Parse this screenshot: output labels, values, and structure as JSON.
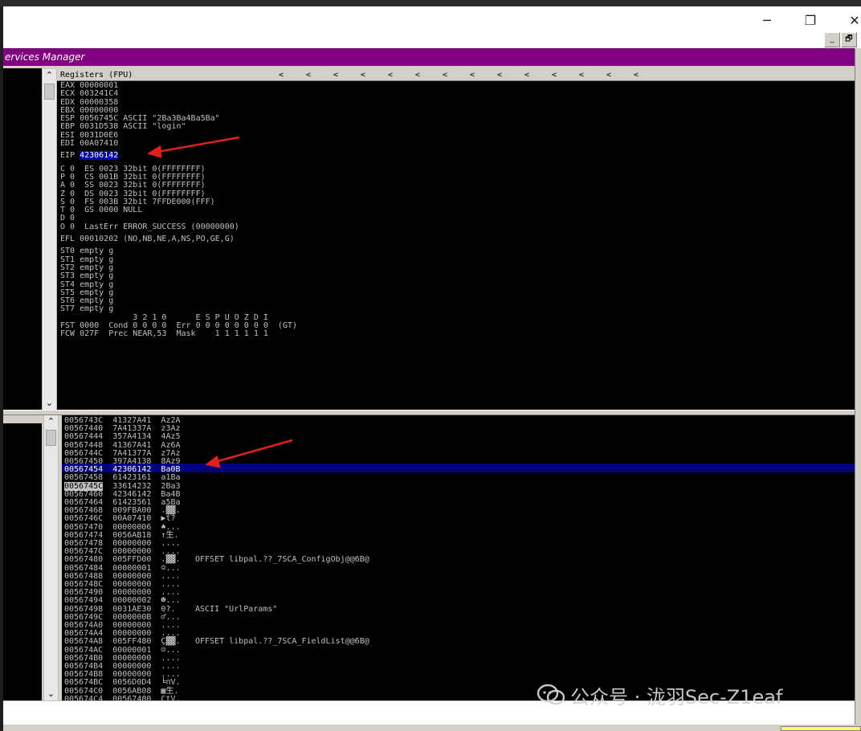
{
  "window": {
    "minimize": "─",
    "restore": "❐",
    "close": "✕",
    "mdi_minimize": "_",
    "mdi_restore": "🗗"
  },
  "mdi_title": "ervices Manager",
  "registers": {
    "header": "Registers (FPU)",
    "arrows": [
      "<",
      "<",
      "<",
      "<",
      "<",
      "<",
      "<",
      "<",
      "<",
      "<",
      "<",
      "<",
      "<",
      "<"
    ],
    "lines1": [
      "EAX 00000001",
      "ECX 003241C4",
      "EDX 00000358",
      "EBX 00000000",
      "ESP 0056745C ASCII \"2Ba3Ba4Ba5Ba\"",
      "EBP 0031D538 ASCII \"login\"",
      "ESI 0031D0E6",
      "EDI 00A07410"
    ],
    "eip_label": "EIP ",
    "eip_value": "42306142",
    "flags": [
      "C 0  ES 0023 32bit 0(FFFFFFFF)",
      "P 0  CS 001B 32bit 0(FFFFFFFF)",
      "A 0  SS 0023 32bit 0(FFFFFFFF)",
      "Z 0  DS 0023 32bit 0(FFFFFFFF)",
      "S 0  FS 003B 32bit 7FFDE000(FFF)",
      "T 0  GS 0000 NULL",
      "D 0",
      "O 0  LastErr ERROR_SUCCESS (00000000)"
    ],
    "efl": "EFL 00010202 (NO,NB,NE,A,NS,PO,GE,G)",
    "st": [
      "ST0 empty g",
      "ST1 empty g",
      "ST2 empty g",
      "ST3 empty g",
      "ST4 empty g",
      "ST5 empty g",
      "ST6 empty g",
      "ST7 empty g"
    ],
    "fpu": [
      "               3 2 1 0      E S P U O Z D I",
      "FST 0000  Cond 0 0 0 0  Err 0 0 0 0 0 0 0 0  (GT)",
      "FCW 027F  Prec NEAR,53  Mask    1 1 1 1 1 1"
    ]
  },
  "stack": {
    "rows": [
      {
        "addr": "0056743C",
        "val": "41327A41",
        "ascii": "Az2A",
        "comment": ""
      },
      {
        "addr": "00567440",
        "val": "7A41337A",
        "ascii": "z3Az",
        "comment": ""
      },
      {
        "addr": "00567444",
        "val": "357A4134",
        "ascii": "4Az5",
        "comment": ""
      },
      {
        "addr": "00567448",
        "val": "41367A41",
        "ascii": "Az6A",
        "comment": ""
      },
      {
        "addr": "0056744C",
        "val": "7A41377A",
        "ascii": "z7Az",
        "comment": ""
      },
      {
        "addr": "00567450",
        "val": "397A4138",
        "ascii": "8Az9",
        "comment": ""
      },
      {
        "addr": "00567454",
        "val": "42306142",
        "ascii": "Ba0B",
        "comment": ""
      },
      {
        "addr": "00567458",
        "val": "61423161",
        "ascii": "a1Ba",
        "comment": ""
      },
      {
        "addr": "0056745C",
        "val": "33614232",
        "ascii": "2Ba3",
        "comment": ""
      },
      {
        "addr": "00567460",
        "val": "42346142",
        "ascii": "Ba4B",
        "comment": ""
      },
      {
        "addr": "00567464",
        "val": "61423561",
        "ascii": "a5Ba",
        "comment": ""
      },
      {
        "addr": "00567468",
        "val": "009FBA00",
        "ascii": ".▓▓.",
        "comment": ""
      },
      {
        "addr": "0056746C",
        "val": "00A07410",
        "ascii": "▶t?",
        "comment": ""
      },
      {
        "addr": "00567470",
        "val": "00000006",
        "ascii": "♠...",
        "comment": ""
      },
      {
        "addr": "00567474",
        "val": "0056AB18",
        "ascii": "↑生.",
        "comment": ""
      },
      {
        "addr": "00567478",
        "val": "00000000",
        "ascii": "....",
        "comment": ""
      },
      {
        "addr": "0056747C",
        "val": "00000000",
        "ascii": "....",
        "comment": ""
      },
      {
        "addr": "00567480",
        "val": "005FFD00",
        "ascii": ".▓▓.",
        "comment": "OFFSET libpal.??_7SCA_ConfigObj@@6B@"
      },
      {
        "addr": "00567484",
        "val": "00000001",
        "ascii": "☺...",
        "comment": ""
      },
      {
        "addr": "00567488",
        "val": "00000000",
        "ascii": "....",
        "comment": ""
      },
      {
        "addr": "0056748C",
        "val": "00000000",
        "ascii": "....",
        "comment": ""
      },
      {
        "addr": "00567490",
        "val": "00000000",
        "ascii": "....",
        "comment": ""
      },
      {
        "addr": "00567494",
        "val": "00000002",
        "ascii": "☻...",
        "comment": ""
      },
      {
        "addr": "00567498",
        "val": "0031AE30",
        "ascii": "0?.",
        "comment": "ASCII \"UrlParams\""
      },
      {
        "addr": "0056749C",
        "val": "0000000B",
        "ascii": "♂...",
        "comment": ""
      },
      {
        "addr": "005674A0",
        "val": "00000000",
        "ascii": "....",
        "comment": ""
      },
      {
        "addr": "005674A4",
        "val": "00000000",
        "ascii": "....",
        "comment": ""
      },
      {
        "addr": "005674A8",
        "val": "005FF480",
        "ascii": "Ç▓▓.",
        "comment": "OFFSET libpal.??_7SCA_FieldList@@6B@"
      },
      {
        "addr": "005674AC",
        "val": "00000001",
        "ascii": "☺...",
        "comment": ""
      },
      {
        "addr": "005674B0",
        "val": "00000000",
        "ascii": "....",
        "comment": ""
      },
      {
        "addr": "005674B4",
        "val": "00000000",
        "ascii": "....",
        "comment": ""
      },
      {
        "addr": "005674B8",
        "val": "00000000",
        "ascii": "....",
        "comment": ""
      },
      {
        "addr": "005674BC",
        "val": "0056D0D4",
        "ascii": "╘пV.",
        "comment": ""
      },
      {
        "addr": "005674C0",
        "val": "0056AB08",
        "ascii": "▩生.",
        "comment": ""
      },
      {
        "addr": "005674C4",
        "val": "00567480",
        "ascii": "ÇtV.",
        "comment": ""
      }
    ],
    "highlight_index": 6,
    "boxed_index": 8
  },
  "watermark": "公众号 · 泷羽Sec-Z1eaf",
  "colors": {
    "mdi_title_bg": "#800080",
    "pane_bg": "#000000",
    "highlight": "#000080",
    "eip_bg": "#0000a0",
    "arrow": "#e02020"
  }
}
